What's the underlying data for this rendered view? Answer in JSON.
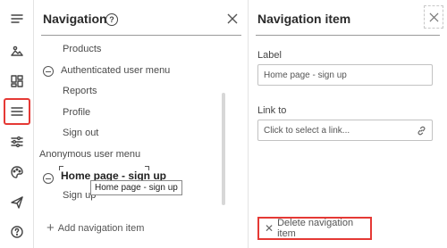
{
  "rail": {
    "icons": [
      "menu-icon",
      "image-icon",
      "layout-icon",
      "navigation-icon",
      "sliders-icon",
      "palette-icon",
      "send-icon",
      "help-icon"
    ]
  },
  "navigation_panel": {
    "title": "Navigation",
    "help_glyph": "?",
    "tree": [
      {
        "label": "Products"
      },
      {
        "label": "Authenticated user menu"
      },
      {
        "label": "Reports"
      },
      {
        "label": "Profile"
      },
      {
        "label": "Sign out"
      },
      {
        "label": "Anonymous user menu"
      },
      {
        "label": "Home page - sign up"
      },
      {
        "label": "Sign up"
      }
    ],
    "tooltip": "Home page - sign up",
    "add_button": "Add navigation item"
  },
  "item_panel": {
    "title": "Navigation item",
    "label_field": {
      "label": "Label",
      "value": "Home page - sign up"
    },
    "link_field": {
      "label": "Link to",
      "placeholder": "Click to select a link..."
    },
    "delete_button": "Delete navigation item"
  },
  "colors": {
    "highlight": "#e53935"
  }
}
